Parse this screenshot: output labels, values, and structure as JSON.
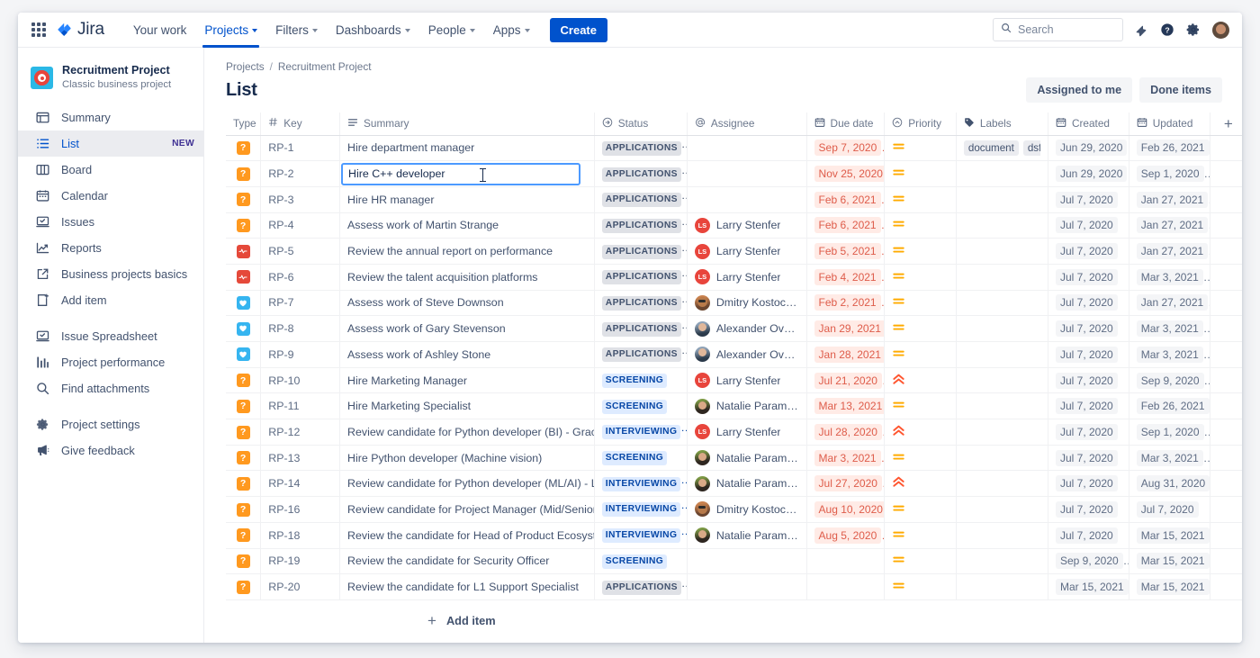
{
  "topnav": {
    "app_switcher": "app-switcher",
    "logo_text": "Jira",
    "items": [
      {
        "label": "Your work",
        "has_caret": false,
        "active": false
      },
      {
        "label": "Projects",
        "has_caret": true,
        "active": true
      },
      {
        "label": "Filters",
        "has_caret": true,
        "active": false
      },
      {
        "label": "Dashboards",
        "has_caret": true,
        "active": false
      },
      {
        "label": "People",
        "has_caret": true,
        "active": false
      },
      {
        "label": "Apps",
        "has_caret": true,
        "active": false
      }
    ],
    "create_label": "Create",
    "search_placeholder": "Search",
    "icons": [
      "notification-bell-icon",
      "help-icon",
      "settings-gear-icon",
      "user-avatar"
    ]
  },
  "sidebar": {
    "project_name": "Recruitment Project",
    "project_type": "Classic business project",
    "items": [
      {
        "label": "Summary",
        "icon": "summary-icon",
        "selected": false,
        "badge": ""
      },
      {
        "label": "List",
        "icon": "list-icon",
        "selected": true,
        "badge": "NEW"
      },
      {
        "label": "Board",
        "icon": "board-icon",
        "selected": false,
        "badge": ""
      },
      {
        "label": "Calendar",
        "icon": "calendar-icon",
        "selected": false,
        "badge": ""
      },
      {
        "label": "Issues",
        "icon": "issues-icon",
        "selected": false,
        "badge": ""
      },
      {
        "label": "Reports",
        "icon": "reports-icon",
        "selected": false,
        "badge": ""
      },
      {
        "label": "Business projects basics",
        "icon": "external-link-icon",
        "selected": false,
        "badge": ""
      },
      {
        "label": "Add item",
        "icon": "add-item-icon",
        "selected": false,
        "badge": ""
      }
    ],
    "items2": [
      {
        "label": "Issue Spreadsheet",
        "icon": "spreadsheet-icon"
      },
      {
        "label": "Project performance",
        "icon": "chart-bar-icon"
      },
      {
        "label": "Find attachments",
        "icon": "search-icon"
      }
    ],
    "items3": [
      {
        "label": "Project settings",
        "icon": "gear-icon"
      },
      {
        "label": "Give feedback",
        "icon": "megaphone-icon"
      }
    ]
  },
  "header": {
    "breadcrumb_root": "Projects",
    "breadcrumb_sep": "/",
    "breadcrumb_project": "Recruitment Project",
    "title": "List",
    "assigned_to_me": "Assigned to me",
    "done_items": "Done items"
  },
  "table": {
    "columns": [
      {
        "label": "Type",
        "icon": ""
      },
      {
        "label": "Key",
        "icon": "hash-icon"
      },
      {
        "label": "Summary",
        "icon": "text-lines-icon"
      },
      {
        "label": "Status",
        "icon": "arrow-circle-icon"
      },
      {
        "label": "Assignee",
        "icon": "at-icon"
      },
      {
        "label": "Due date",
        "icon": "calendar-icon"
      },
      {
        "label": "Priority",
        "icon": "chevron-circle-icon"
      },
      {
        "label": "Labels",
        "icon": "tag-icon"
      },
      {
        "label": "Created",
        "icon": "calendar-icon"
      },
      {
        "label": "Updated",
        "icon": "calendar-icon"
      }
    ],
    "add_column_icon": "plus-icon",
    "add_item_label": "Add item",
    "rows": [
      {
        "type": "task",
        "key": "RP-1",
        "summary": "Hire department manager",
        "status": "APPLICATIONS",
        "status_style": "gray",
        "assignee": "",
        "avatar": "",
        "due": "Sep 7, 2020",
        "priority": "medium",
        "labels": [
          "document",
          "dsfsdf"
        ],
        "labels_more": "…",
        "created": "Jun 29, 2020",
        "updated": "Feb 26, 2021",
        "editing": false
      },
      {
        "type": "task",
        "key": "RP-2",
        "summary": "Hire C++ developer",
        "status": "APPLICATIONS",
        "status_style": "gray",
        "assignee": "",
        "avatar": "",
        "due": "Nov 25, 2020",
        "priority": "medium",
        "labels": [],
        "labels_more": "",
        "created": "Jun 29, 2020",
        "updated": "Sep 1, 2020",
        "editing": true
      },
      {
        "type": "task",
        "key": "RP-3",
        "summary": "Hire HR manager",
        "status": "APPLICATIONS",
        "status_style": "gray",
        "assignee": "",
        "avatar": "",
        "due": "Feb 6, 2021",
        "priority": "medium",
        "labels": [],
        "labels_more": "",
        "created": "Jul 7, 2020",
        "updated": "Jan 27, 2021",
        "editing": false
      },
      {
        "type": "task",
        "key": "RP-4",
        "summary": "Assess work of Martin Strange",
        "status": "APPLICATIONS",
        "status_style": "gray",
        "assignee": "Larry Stenfer",
        "avatar": "initials-LS",
        "due": "Feb 6, 2021",
        "priority": "medium",
        "labels": [],
        "labels_more": "",
        "created": "Jul 7, 2020",
        "updated": "Jan 27, 2021",
        "editing": false
      },
      {
        "type": "bug",
        "key": "RP-5",
        "summary": "Review the annual report on performance",
        "status": "APPLICATIONS",
        "status_style": "gray",
        "assignee": "Larry Stenfer",
        "avatar": "initials-LS",
        "due": "Feb 5, 2021",
        "priority": "medium",
        "labels": [],
        "labels_more": "",
        "created": "Jul 7, 2020",
        "updated": "Jan 27, 2021",
        "editing": false
      },
      {
        "type": "bug",
        "key": "RP-6",
        "summary": "Review the talent acquisition platforms",
        "status": "APPLICATIONS",
        "status_style": "gray",
        "assignee": "Larry Stenfer",
        "avatar": "initials-LS",
        "due": "Feb 4, 2021",
        "priority": "medium",
        "labels": [],
        "labels_more": "",
        "created": "Jul 7, 2020",
        "updated": "Mar 3, 2021",
        "editing": false
      },
      {
        "type": "story",
        "key": "RP-7",
        "summary": "Assess work of Steve Downson",
        "status": "APPLICATIONS",
        "status_style": "gray",
        "assignee": "Dmitry Kostochko",
        "avatar": "photo-a",
        "due": "Feb 2, 2021",
        "priority": "medium",
        "labels": [],
        "labels_more": "",
        "created": "Jul 7, 2020",
        "updated": "Jan 27, 2021",
        "editing": false
      },
      {
        "type": "story",
        "key": "RP-8",
        "summary": "Assess work of Gary Stevenson",
        "status": "APPLICATIONS",
        "status_style": "gray",
        "assignee": "Alexander Ovsyannikov",
        "avatar": "photo-b",
        "due": "Jan 29, 2021",
        "priority": "medium",
        "labels": [],
        "labels_more": "",
        "created": "Jul 7, 2020",
        "updated": "Mar 3, 2021",
        "editing": false
      },
      {
        "type": "story",
        "key": "RP-9",
        "summary": "Assess work of Ashley Stone",
        "status": "APPLICATIONS",
        "status_style": "gray",
        "assignee": "Alexander Ovsyannikov",
        "avatar": "photo-b",
        "due": "Jan 28, 2021",
        "priority": "medium",
        "labels": [],
        "labels_more": "",
        "created": "Jul 7, 2020",
        "updated": "Mar 3, 2021",
        "editing": false
      },
      {
        "type": "task",
        "key": "RP-10",
        "summary": "Hire Marketing Manager",
        "status": "SCREENING",
        "status_style": "blue",
        "assignee": "Larry Stenfer",
        "avatar": "initials-LS",
        "due": "Jul 21, 2020",
        "priority": "high",
        "labels": [],
        "labels_more": "",
        "created": "Jul 7, 2020",
        "updated": "Sep 9, 2020",
        "editing": false
      },
      {
        "type": "task",
        "key": "RP-11",
        "summary": "Hire Marketing Specialist",
        "status": "SCREENING",
        "status_style": "blue",
        "assignee": "Natalie Paramonova",
        "avatar": "photo-c",
        "due": "Mar 13, 2021",
        "priority": "medium",
        "labels": [],
        "labels_more": "",
        "created": "Jul 7, 2020",
        "updated": "Feb 26, 2021",
        "editing": false
      },
      {
        "type": "task",
        "key": "RP-12",
        "summary": "Review candidate for Python developer (BI) - Gracey Fenton",
        "status": "INTERVIEWING",
        "status_style": "blue",
        "assignee": "Larry Stenfer",
        "avatar": "initials-LS",
        "due": "Jul 28, 2020",
        "priority": "high",
        "labels": [],
        "labels_more": "",
        "created": "Jul 7, 2020",
        "updated": "Sep 1, 2020",
        "editing": false
      },
      {
        "type": "task",
        "key": "RP-13",
        "summary": "Hire Python developer (Machine vision)",
        "status": "SCREENING",
        "status_style": "blue",
        "assignee": "Natalie Paramonova",
        "avatar": "photo-c",
        "due": "Mar 3, 2021",
        "priority": "medium",
        "labels": [],
        "labels_more": "",
        "created": "Jul 7, 2020",
        "updated": "Mar 3, 2021",
        "editing": false
      },
      {
        "type": "task",
        "key": "RP-14",
        "summary": "Review candidate for Python developer (ML/AI) - Lex Moreno",
        "status": "INTERVIEWING",
        "status_style": "blue",
        "assignee": "Natalie Paramonova",
        "avatar": "photo-c",
        "due": "Jul 27, 2020",
        "priority": "high",
        "labels": [],
        "labels_more": "",
        "created": "Jul 7, 2020",
        "updated": "Aug 31, 2020",
        "editing": false
      },
      {
        "type": "task",
        "key": "RP-16",
        "summary": "Review candidate for Project Manager (Mid/Senior) - Nadine …",
        "status": "INTERVIEWING",
        "status_style": "blue",
        "assignee": "Dmitry Kostochko",
        "avatar": "photo-a",
        "due": "Aug 10, 2020",
        "priority": "medium",
        "labels": [],
        "labels_more": "",
        "created": "Jul 7, 2020",
        "updated": "Jul 7, 2020",
        "editing": false
      },
      {
        "type": "task",
        "key": "RP-18",
        "summary": "Review the candidate for Head of Product Ecosystem",
        "status": "INTERVIEWING",
        "status_style": "blue",
        "assignee": "Natalie Paramonova",
        "avatar": "photo-c",
        "due": "Aug 5, 2020",
        "priority": "medium",
        "labels": [],
        "labels_more": "",
        "created": "Jul 7, 2020",
        "updated": "Mar 15, 2021",
        "editing": false
      },
      {
        "type": "task",
        "key": "RP-19",
        "summary": "Review the candidate for Security Officer",
        "status": "SCREENING",
        "status_style": "blue",
        "assignee": "",
        "avatar": "",
        "due": "",
        "priority": "medium",
        "labels": [],
        "labels_more": "",
        "created": "Sep 9, 2020",
        "updated": "Mar 15, 2021",
        "editing": false
      },
      {
        "type": "task",
        "key": "RP-20",
        "summary": "Review the candidate for L1 Support Specialist",
        "status": "APPLICATIONS",
        "status_style": "gray",
        "assignee": "",
        "avatar": "",
        "due": "",
        "priority": "medium",
        "labels": [],
        "labels_more": "",
        "created": "Mar 15, 2021",
        "updated": "Mar 15, 2021",
        "editing": false
      }
    ]
  },
  "colors": {
    "brand_blue": "#0052cc",
    "task_orange": "#ff991f",
    "bug_red": "#e5493a",
    "story_blue": "#36b5f0",
    "due_pill_bg": "#ffebe6",
    "due_pill_text": "#de5c4a",
    "status_blue_bg": "#deebff",
    "status_gray_bg": "#dfe1e6"
  }
}
